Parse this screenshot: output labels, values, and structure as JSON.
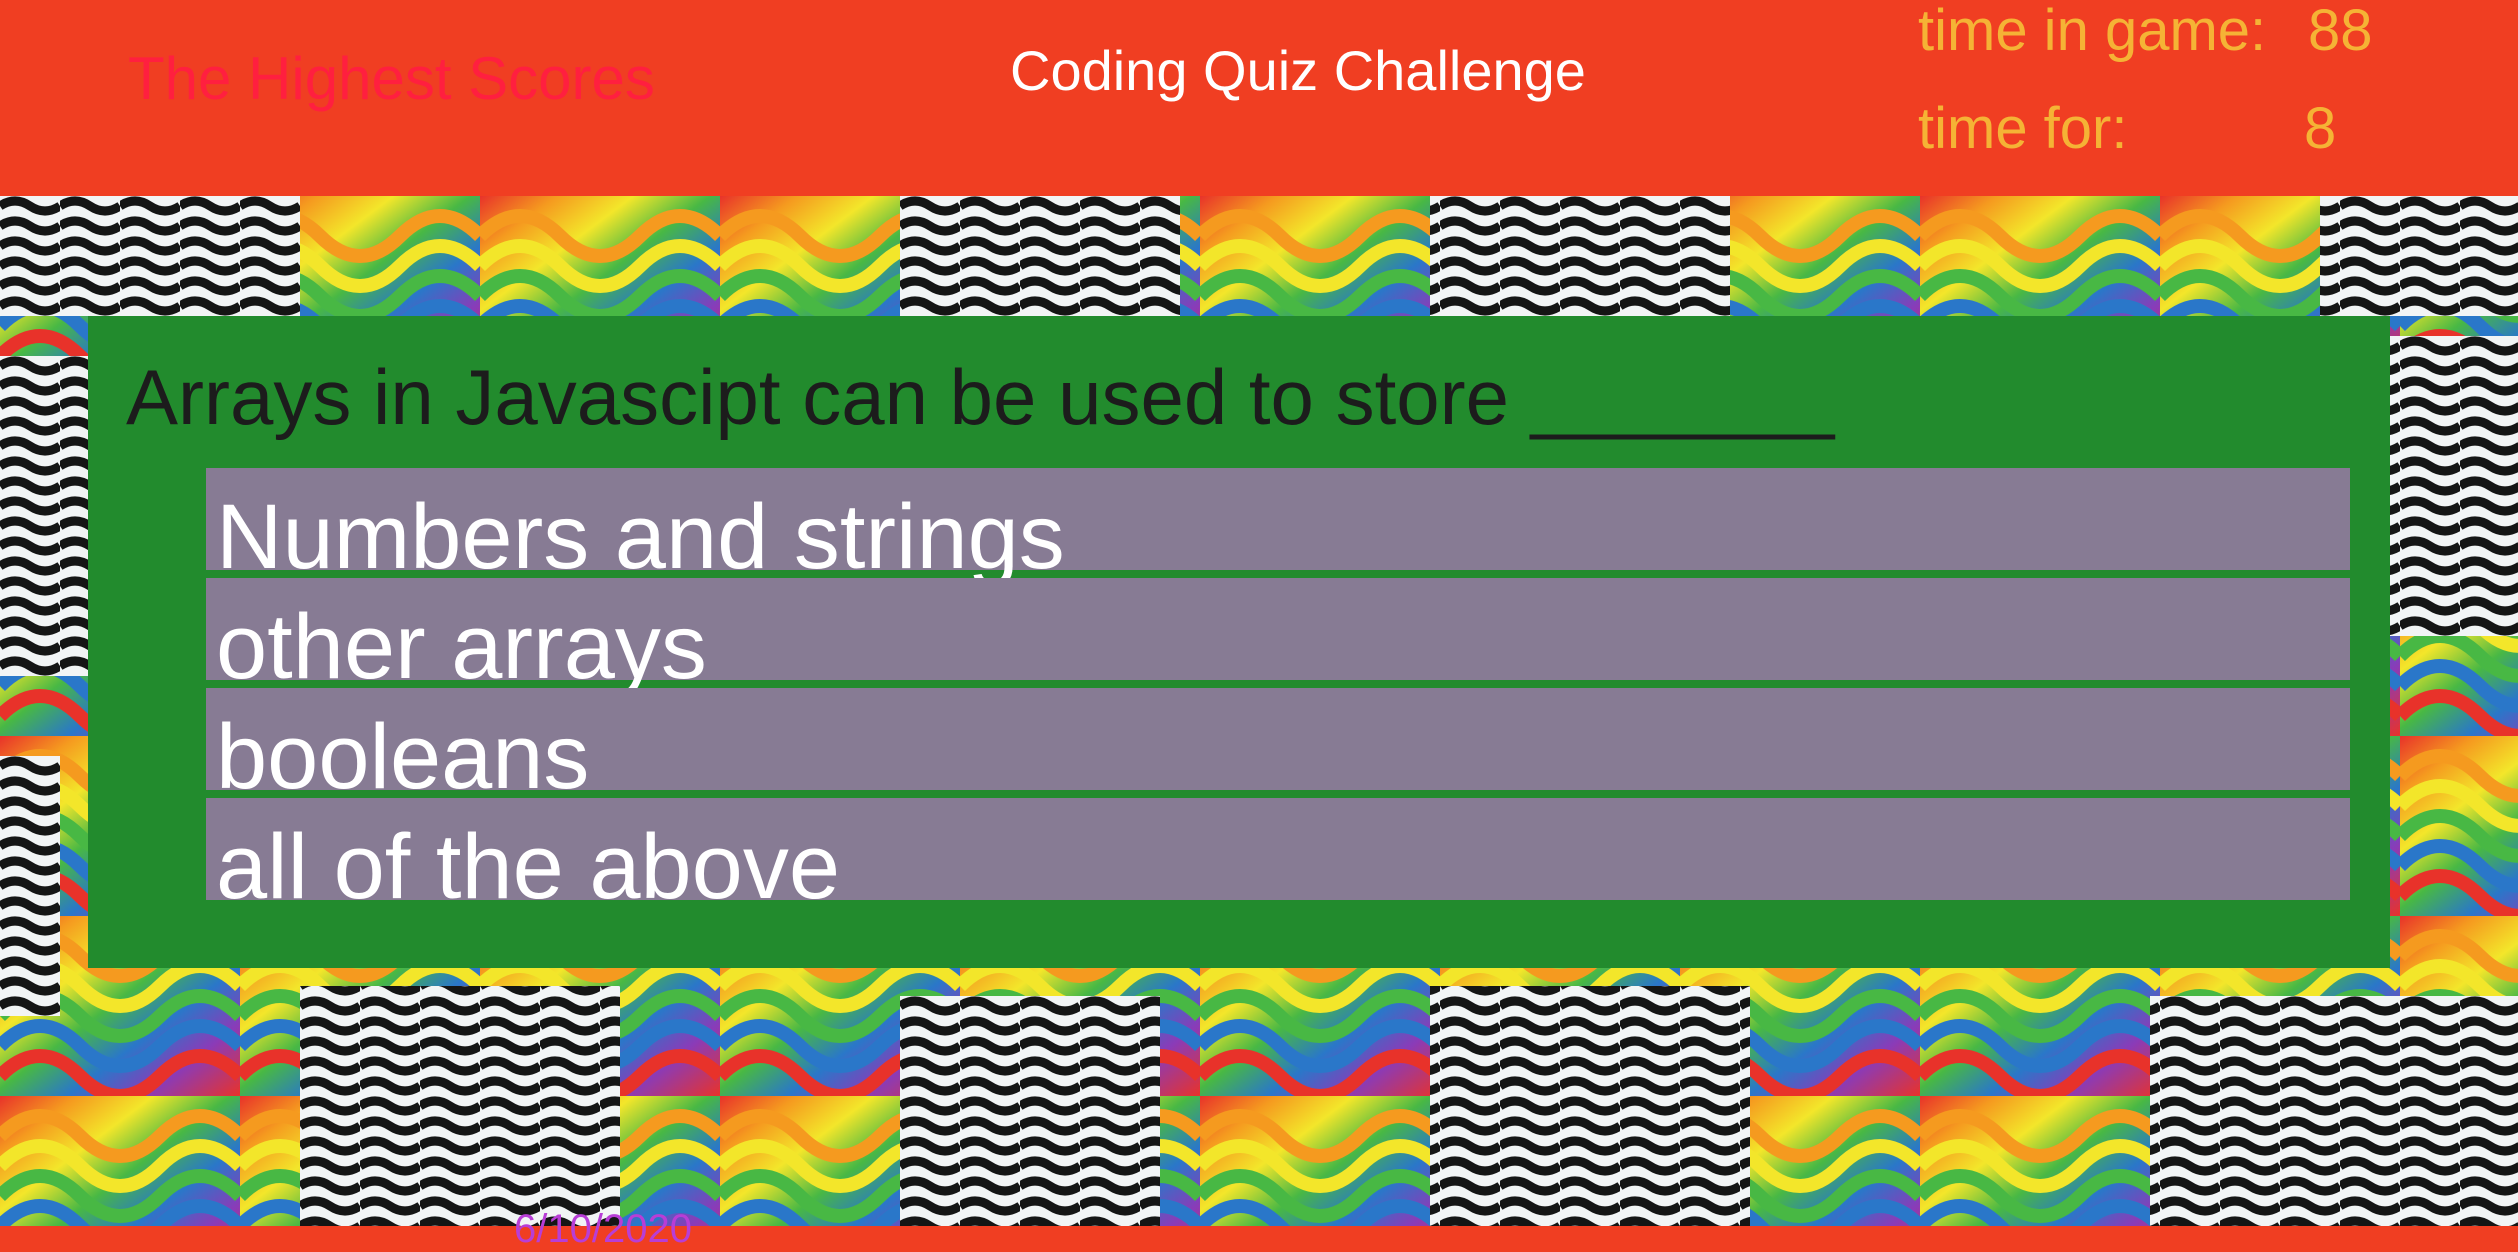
{
  "header": {
    "highscores_link": "The Highest Scores",
    "title": "Coding Quiz Challenge",
    "timer_game_label": "time in game:",
    "timer_game_value": "88",
    "timer_question_label": "time for:",
    "timer_question_value": "8"
  },
  "quiz": {
    "question": "Arrays in Javascipt can be used to store _______",
    "answers": [
      "Numbers and strings",
      "other arrays",
      "booleans",
      "all of the above"
    ]
  },
  "footer": {
    "date": "6/10/2020"
  },
  "colors": {
    "header_bg": "#f03e22",
    "highscores_link": "#ff1f3f",
    "title": "#ffffff",
    "timer": "#f5b335",
    "card_bg": "#228b2d",
    "answer_bg": "#877b94",
    "footer_date": "#b83dd6"
  }
}
